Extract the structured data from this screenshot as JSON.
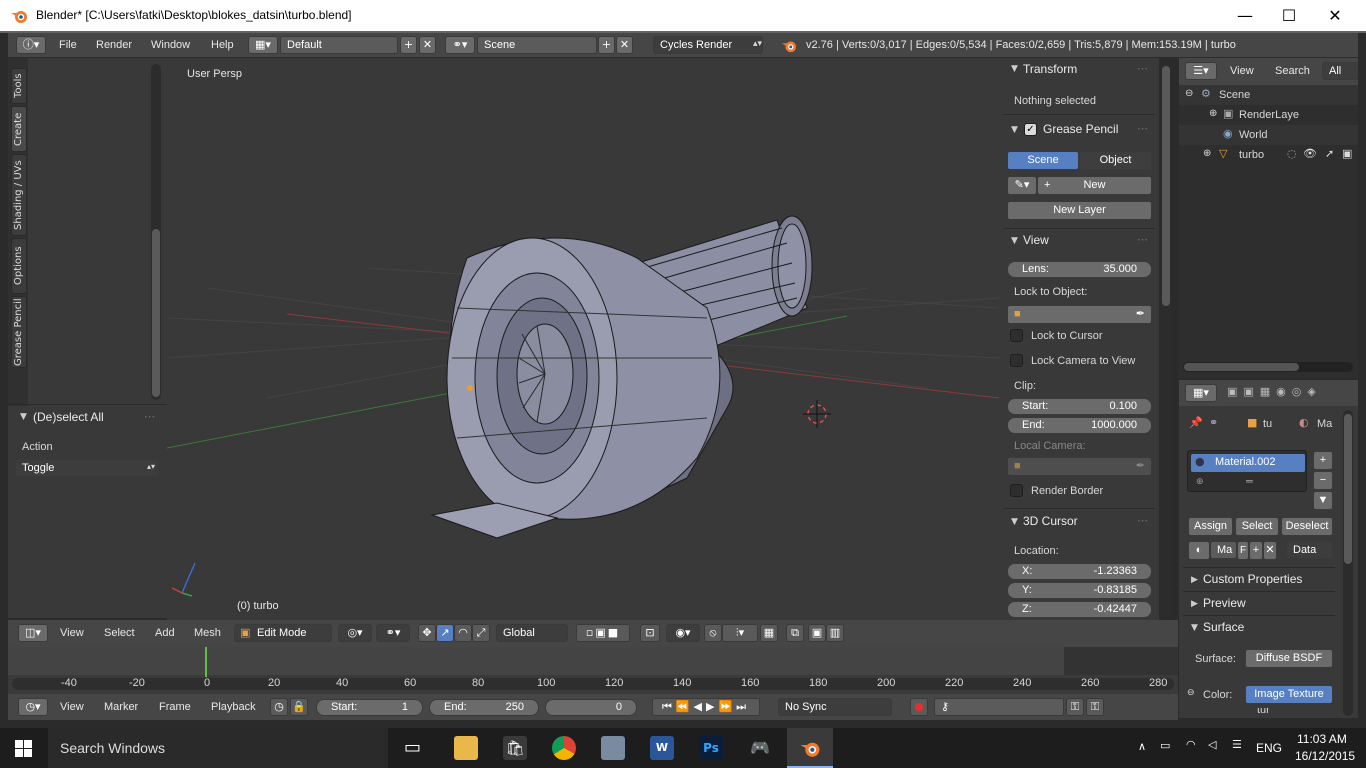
{
  "window": {
    "title": "Blender* [C:\\Users\\fatki\\Desktop\\blokes_datsin\\turbo.blend]",
    "minimize": "—",
    "maximize": "☐",
    "close": "✕"
  },
  "topbar": {
    "menus": [
      "File",
      "Render",
      "Window",
      "Help"
    ],
    "layout": "Default",
    "scene": "Scene",
    "engine": "Cycles Render",
    "stats": "v2.76 | Verts:0/3,017 | Edges:0/5,534 | Faces:0/2,659 | Tris:5,879 | Mem:153.19M | turbo"
  },
  "toolshelf": {
    "tabs": [
      "Tools",
      "Create",
      "Shading / UVs",
      "Options",
      "Grease Pencil"
    ],
    "operator_title": "(De)select All",
    "action_label": "Action",
    "action_value": "Toggle"
  },
  "viewport": {
    "view_label": "User Persp",
    "object_label": "(0) turbo"
  },
  "properties_panel": {
    "transform": {
      "title": "Transform",
      "info": "Nothing selected"
    },
    "grease_pencil": {
      "title": "Grease Pencil",
      "scene_tab": "Scene",
      "object_tab": "Object",
      "new": "New",
      "new_layer": "New Layer"
    },
    "view": {
      "title": "View",
      "lens_label": "Lens:",
      "lens_value": "35.000",
      "lock_object": "Lock to Object:",
      "lock_cursor": "Lock to Cursor",
      "lock_camera": "Lock Camera to View",
      "clip": "Clip:",
      "start_label": "Start:",
      "start_value": "0.100",
      "end_label": "End:",
      "end_value": "1000.000",
      "local_camera": "Local Camera:",
      "render_border": "Render Border"
    },
    "cursor": {
      "title": "3D Cursor",
      "location": "Location:",
      "x_label": "X:",
      "x_value": "-1.23363",
      "y_label": "Y:",
      "y_value": "-0.83185",
      "z_label": "Z:",
      "z_value": "-0.42447"
    }
  },
  "outliner": {
    "menus": [
      "View",
      "Search",
      "All Sc"
    ],
    "items": [
      "Scene",
      "RenderLaye",
      "World",
      "turbo"
    ]
  },
  "material": {
    "crumbs": [
      "tu",
      "Ma"
    ],
    "slot": "Material.002",
    "assign": "Assign",
    "select": "Select",
    "deselect": "Deselect",
    "mat_name": "Ma",
    "f": "F",
    "data": "Data",
    "custom_props": "Custom Properties",
    "preview": "Preview",
    "surface": "Surface",
    "surface_label": "Surface:",
    "surface_value": "Diffuse BSDF",
    "color_label": "Color:",
    "color_value": "Image Texture",
    "extra_value": "tur"
  },
  "viewport_header": {
    "menus": [
      "View",
      "Select",
      "Add",
      "Mesh"
    ],
    "mode": "Edit Mode",
    "orientation": "Global"
  },
  "timeline": {
    "ticks": [
      "-40",
      "-20",
      "0",
      "20",
      "40",
      "60",
      "80",
      "100",
      "120",
      "140",
      "160",
      "180",
      "200",
      "220",
      "240",
      "260",
      "280"
    ],
    "menus": [
      "View",
      "Marker",
      "Frame",
      "Playback"
    ],
    "start_label": "Start:",
    "start_value": "1",
    "end_label": "End:",
    "end_value": "250",
    "current": "0",
    "sync": "No Sync"
  },
  "taskbar": {
    "search": "Search Windows",
    "time": "11:03 AM",
    "date": "16/12/2015",
    "lang": "ENG"
  },
  "colors": {
    "viewport_bg": "#393939",
    "selected_blue": "#5680c2",
    "mesh": "#8d8fa3"
  }
}
